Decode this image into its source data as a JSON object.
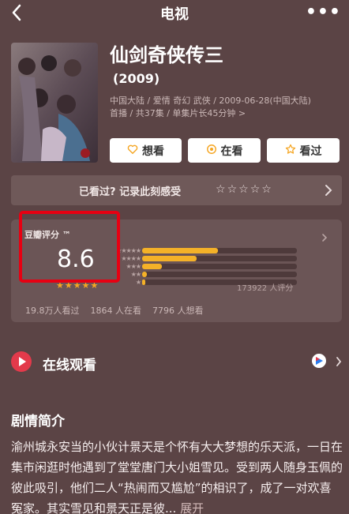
{
  "header": {
    "title": "电视",
    "more_label": "•••"
  },
  "movie": {
    "name": "仙剑奇侠传三",
    "year": "(2009)",
    "meta_line1": "中国大陆 / 爱情 奇幻 武侠 / 2009-06-28(中国大陆)",
    "meta_line2": "首播 / 共37集 / 单集片长45分钟",
    "meta_more": ">"
  },
  "actions": {
    "want_label": "想看",
    "watching_label": "在看",
    "watched_label": "看过"
  },
  "record": {
    "prompt": "已看过? 记录此刻感受",
    "stars": [
      "☆",
      "☆",
      "☆",
      "☆",
      "☆"
    ]
  },
  "rating": {
    "label": "豆瓣评分 ™",
    "score": "8.6",
    "score_stars": [
      "★",
      "★",
      "★",
      "★",
      "★"
    ],
    "distribution_stars": [
      "★★★★★",
      "★★★★",
      "★★★",
      "★★",
      "★"
    ],
    "count_label": "173922 人评分"
  },
  "stats": {
    "seen": "19.8万人看过",
    "watching": "1864 人在看",
    "want": "7796 人想看"
  },
  "online": {
    "title": "在线观看"
  },
  "synopsis": {
    "title": "剧情简介",
    "text": "渝州城永安当的小伙计景天是个怀有大大梦想的乐天派，一日在集市闲逛时他遇到了堂堂唐门大小姐雪见。受到两人随身玉佩的彼此吸引，他们二人“热闹而又尴尬”的相识了，成了一对欢喜冤家。其实雪见和景天正是彼...",
    "expand_label": "展开"
  },
  "colors": {
    "accent_star": "#f4b128",
    "highlight": "#e60012",
    "play": "#e33a4b",
    "background": "#5b4445"
  }
}
